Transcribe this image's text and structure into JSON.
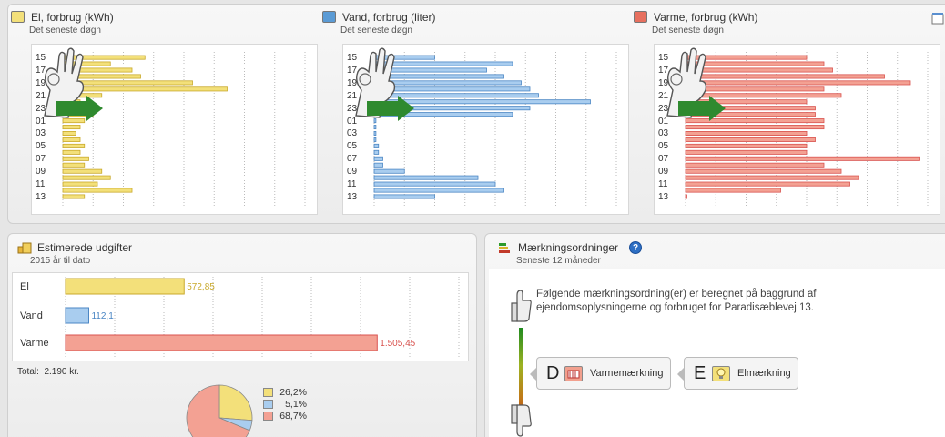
{
  "consumption": {
    "hours": [
      "15",
      "17",
      "19",
      "21",
      "23",
      "01",
      "03",
      "05",
      "07",
      "09",
      "11",
      "13"
    ],
    "modules": [
      {
        "key": "el",
        "title": "El, forbrug (kWh)",
        "subtitle": "Det seneste døgn",
        "icon": "lightbulb-icon",
        "color": "#f3e07a",
        "stroke": "#c9a92b",
        "values": [
          0.95,
          0.55,
          0.8,
          0.9,
          1.5,
          1.9,
          0.45,
          0.2,
          0.3,
          0.35,
          0.25,
          0.2,
          0.15,
          0.2,
          0.25,
          0.2,
          0.3,
          0.25,
          0.45,
          0.55,
          0.4,
          0.8,
          0.25
        ]
      },
      {
        "key": "vand",
        "title": "Vand, forbrug (liter)",
        "subtitle": "Det seneste døgn",
        "icon": "water-tap-icon",
        "color": "#a9cdef",
        "stroke": "#4a86c4",
        "values": [
          0.7,
          1.6,
          1.3,
          1.5,
          1.7,
          1.8,
          1.9,
          2.5,
          1.8,
          1.6,
          0.02,
          0.02,
          0.02,
          0.02,
          0.05,
          0.05,
          0.1,
          0.1,
          0.35,
          1.2,
          1.4,
          1.5,
          0.7
        ]
      },
      {
        "key": "varme",
        "title": "Varme, forbrug (kWh)",
        "subtitle": "Det seneste døgn",
        "icon": "radiator-icon",
        "color": "#f3a193",
        "stroke": "#d9534f",
        "values": [
          1.4,
          1.6,
          1.7,
          2.3,
          2.6,
          1.6,
          1.8,
          1.4,
          1.5,
          1.5,
          1.6,
          1.6,
          1.4,
          1.5,
          1.4,
          1.4,
          2.7,
          1.6,
          1.8,
          2.0,
          1.9,
          1.1,
          0.0
        ]
      }
    ]
  },
  "expenses": {
    "title": "Estimerede udgifter",
    "subtitle": "2015 år til dato",
    "rows": [
      {
        "label": "El",
        "value": 572.85,
        "value_text": "572,85",
        "color": "#f3e07a",
        "stroke": "#c9a92b",
        "text_color": "#c9a92b"
      },
      {
        "label": "Vand",
        "value": 112.1,
        "value_text": "112,1",
        "color": "#a9cdef",
        "stroke": "#4a86c4",
        "text_color": "#4a86c4"
      },
      {
        "label": "Varme",
        "value": 1505.45,
        "value_text": "1.505,45",
        "color": "#f3a193",
        "stroke": "#d9534f",
        "text_color": "#d9534f"
      }
    ],
    "total_label": "Total:",
    "total_value": "2.190 kr.",
    "chart_data": {
      "type": "pie",
      "slices": [
        {
          "label": "26,2%",
          "value": 26.2,
          "color": "#f3e07a"
        },
        {
          "label": "5,1%",
          "value": 5.1,
          "color": "#a9cdef"
        },
        {
          "label": "68,7%",
          "value": 68.7,
          "color": "#f3a193"
        }
      ]
    }
  },
  "marking": {
    "title": "Mærkningsordninger",
    "subtitle": "Seneste 12 måneder",
    "help": "?",
    "description": "Følgende mærkningsordning(er) er beregnet på baggrund af ejendomsoplysningerne og forbruget for Paradisæblevej 13.",
    "items": [
      {
        "letter": "D",
        "label": "Varmemærkning",
        "icon": "radiator-icon"
      },
      {
        "letter": "E",
        "label": "Elmærkning",
        "icon": "lightbulb-icon"
      }
    ]
  },
  "chart_data": [
    {
      "type": "bar",
      "orientation": "horizontal",
      "title": "El, forbrug (kWh)",
      "subtitle": "Det seneste døgn",
      "tick_labels": [
        "15",
        "17",
        "19",
        "21",
        "23",
        "01",
        "03",
        "05",
        "07",
        "09",
        "11",
        "13"
      ],
      "values": [
        0.95,
        0.55,
        0.8,
        0.9,
        1.5,
        1.9,
        0.45,
        0.2,
        0.3,
        0.35,
        0.25,
        0.2,
        0.15,
        0.2,
        0.25,
        0.2,
        0.3,
        0.25,
        0.45,
        0.55,
        0.4,
        0.8,
        0.25
      ],
      "grid": true
    },
    {
      "type": "bar",
      "orientation": "horizontal",
      "title": "Vand, forbrug (liter)",
      "subtitle": "Det seneste døgn",
      "tick_labels": [
        "15",
        "17",
        "19",
        "21",
        "23",
        "01",
        "03",
        "05",
        "07",
        "09",
        "11",
        "13"
      ],
      "values": [
        0.7,
        1.6,
        1.3,
        1.5,
        1.7,
        1.8,
        1.9,
        2.5,
        1.8,
        1.6,
        0.02,
        0.02,
        0.02,
        0.02,
        0.05,
        0.05,
        0.1,
        0.1,
        0.35,
        1.2,
        1.4,
        1.5,
        0.7
      ],
      "grid": true
    },
    {
      "type": "bar",
      "orientation": "horizontal",
      "title": "Varme, forbrug (kWh)",
      "subtitle": "Det seneste døgn",
      "tick_labels": [
        "15",
        "17",
        "19",
        "21",
        "23",
        "01",
        "03",
        "05",
        "07",
        "09",
        "11",
        "13"
      ],
      "values": [
        1.4,
        1.6,
        1.7,
        2.3,
        2.6,
        1.6,
        1.8,
        1.4,
        1.5,
        1.5,
        1.6,
        1.6,
        1.4,
        1.5,
        1.4,
        1.4,
        2.7,
        1.6,
        1.8,
        2.0,
        1.9,
        1.1,
        0.0
      ],
      "grid": true
    },
    {
      "type": "bar",
      "orientation": "horizontal",
      "title": "Estimerede udgifter",
      "subtitle": "2015 år til dato",
      "categories": [
        "El",
        "Vand",
        "Varme"
      ],
      "values": [
        572.85,
        112.1,
        1505.45
      ]
    },
    {
      "type": "pie",
      "slices": [
        {
          "label": "26,2%",
          "value": 26.2
        },
        {
          "label": "5,1%",
          "value": 5.1
        },
        {
          "label": "68,7%",
          "value": 68.7
        }
      ]
    }
  ]
}
